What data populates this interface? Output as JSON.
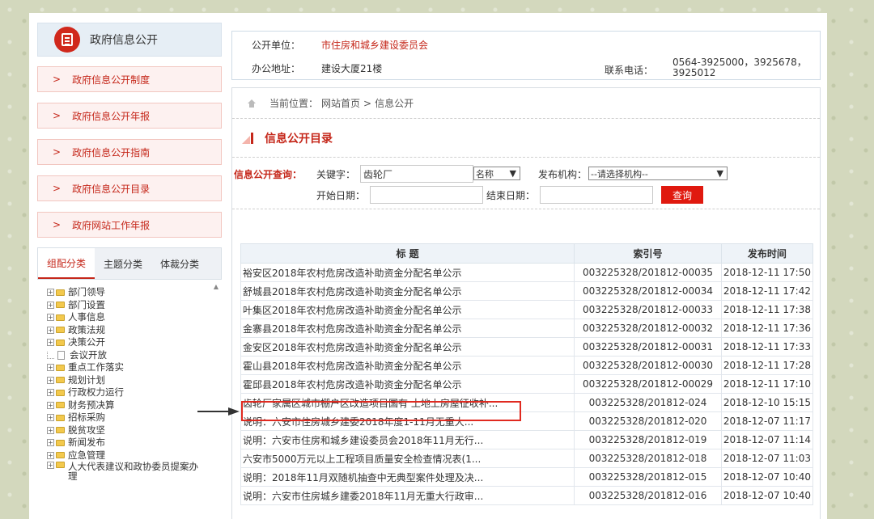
{
  "sidebar": {
    "header_title": "政府信息公开",
    "menu": [
      {
        "label": "政府信息公开制度"
      },
      {
        "label": "政府信息公开年报"
      },
      {
        "label": "政府信息公开指南"
      },
      {
        "label": "政府信息公开目录"
      },
      {
        "label": "政府网站工作年报"
      }
    ],
    "tabs": [
      {
        "label": "组配分类",
        "active": true
      },
      {
        "label": "主题分类",
        "active": false
      },
      {
        "label": "体裁分类",
        "active": false
      }
    ],
    "tree": [
      {
        "label": "部门领导",
        "type": "folder"
      },
      {
        "label": "部门设置",
        "type": "folder"
      },
      {
        "label": "人事信息",
        "type": "folder"
      },
      {
        "label": "政策法规",
        "type": "folder"
      },
      {
        "label": "决策公开",
        "type": "folder"
      },
      {
        "label": "会议开放",
        "type": "doc"
      },
      {
        "label": "重点工作落实",
        "type": "folder"
      },
      {
        "label": "规划计划",
        "type": "folder"
      },
      {
        "label": "行政权力运行",
        "type": "folder"
      },
      {
        "label": "财务预决算",
        "type": "folder"
      },
      {
        "label": "招标采购",
        "type": "folder"
      },
      {
        "label": "脱贫攻坚",
        "type": "folder"
      },
      {
        "label": "新闻发布",
        "type": "folder"
      },
      {
        "label": "应急管理",
        "type": "folder"
      },
      {
        "label": "人大代表建议和政协委员提案办理",
        "type": "folder"
      }
    ]
  },
  "info": {
    "publisher_label": "公开单位：",
    "publisher_value": "市住房和城乡建设委员会",
    "address_label": "办公地址：",
    "address_value": "建设大厦21楼",
    "phone_label": "联系电话：",
    "phone_value_line1": "0564-3925000，3925678，",
    "phone_value_line2": "3925012"
  },
  "breadcrumb": {
    "prefix": "当前位置：",
    "home": "网站首页",
    "sep": ">",
    "current": "信息公开"
  },
  "section_title": "信息公开目录",
  "query": {
    "title": "信息公开查询：",
    "keyword_label": "关键字：",
    "keyword_value": "齿轮厂",
    "field_select": "名称",
    "org_label": "发布机构：",
    "org_select": "--请选择机构--",
    "start_label": "开始日期：",
    "end_label": "结束日期：",
    "search_button": "查询"
  },
  "table": {
    "headers": [
      "标 题",
      "索引号",
      "发布时间"
    ],
    "rows": [
      {
        "title": "裕安区2018年农村危房改造补助资金分配名单公示",
        "index": "003225328/201812-00035",
        "date": "2018-12-11 17:50"
      },
      {
        "title": "舒城县2018年农村危房改造补助资金分配名单公示",
        "index": "003225328/201812-00034",
        "date": "2018-12-11 17:42"
      },
      {
        "title": "叶集区2018年农村危房改造补助资金分配名单公示",
        "index": "003225328/201812-00033",
        "date": "2018-12-11 17:38"
      },
      {
        "title": "金寨县2018年农村危房改造补助资金分配名单公示",
        "index": "003225328/201812-00032",
        "date": "2018-12-11 17:36"
      },
      {
        "title": "金安区2018年农村危房改造补助资金分配名单公示",
        "index": "003225328/201812-00031",
        "date": "2018-12-11 17:33"
      },
      {
        "title": "霍山县2018年农村危房改造补助资金分配名单公示",
        "index": "003225328/201812-00030",
        "date": "2018-12-11 17:28"
      },
      {
        "title": "霍邱县2018年农村危房改造补助资金分配名单公示",
        "index": "003225328/201812-00029",
        "date": "2018-12-11 17:10"
      },
      {
        "title": "齿轮厂家属区城市棚户区改造项目国有 土地上房屋征收补...",
        "index": "003225328/201812-024",
        "date": "2018-12-10 15:15"
      },
      {
        "title": "说明：六安市住房城乡建委2018年度1-11月无重大...",
        "index": "003225328/201812-020",
        "date": "2018-12-07 11:17"
      },
      {
        "title": "说明：六安市住房和城乡建设委员会2018年11月无行...",
        "index": "003225328/201812-019",
        "date": "2018-12-07 11:14"
      },
      {
        "title": "六安市5000万元以上工程项目质量安全检查情况表(1...",
        "index": "003225328/201812-018",
        "date": "2018-12-07 11:03"
      },
      {
        "title": "说明：2018年11月双随机抽查中无典型案件处理及决...",
        "index": "003225328/201812-015",
        "date": "2018-12-07 10:40"
      },
      {
        "title": "说明：六安市住房城乡建委2018年11月无重大行政审...",
        "index": "003225328/201812-016",
        "date": "2018-12-07 10:40"
      }
    ]
  },
  "colors": {
    "accent_red": "#c5271a",
    "button_red": "#e0190f",
    "highlight_border": "#e02a20",
    "page_background": "#d3d8bd"
  }
}
